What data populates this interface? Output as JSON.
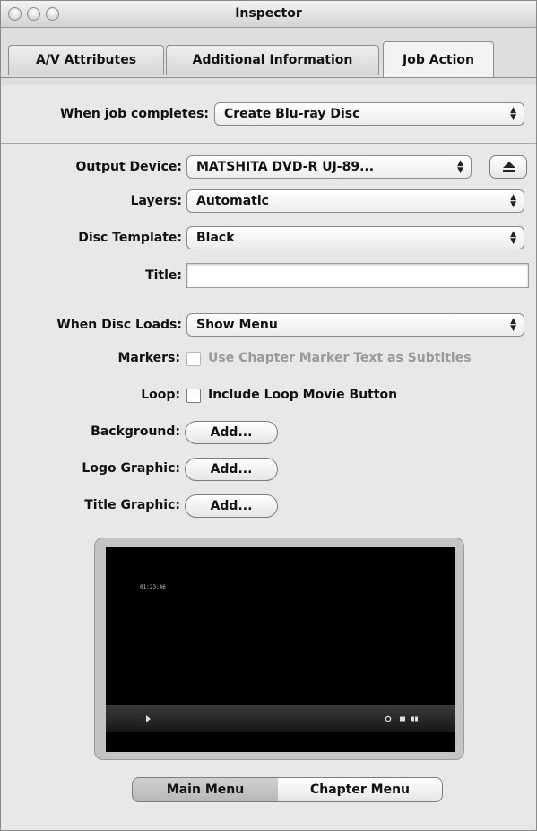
{
  "window": {
    "title": "Inspector"
  },
  "tabs": [
    {
      "label": "A/V Attributes",
      "active": false
    },
    {
      "label": "Additional Information",
      "active": false
    },
    {
      "label": "Job Action",
      "active": true
    }
  ],
  "job": {
    "label": "When job completes:",
    "value": "Create Blu-ray Disc"
  },
  "output_device": {
    "label": "Output Device:",
    "value": "MATSHITA DVD-R   UJ-89..."
  },
  "layers": {
    "label": "Layers:",
    "value": "Automatic"
  },
  "disc_template": {
    "label": "Disc Template:",
    "value": "Black"
  },
  "title_field": {
    "label": "Title:",
    "value": ""
  },
  "when_disc_loads": {
    "label": "When Disc Loads:",
    "value": "Show Menu"
  },
  "markers": {
    "label": "Markers:",
    "checkbox_label": "Use Chapter Marker Text as Subtitles",
    "checked": false,
    "enabled": false
  },
  "loop": {
    "label": "Loop:",
    "checkbox_label": "Include Loop Movie Button",
    "checked": false
  },
  "background": {
    "label": "Background:",
    "button": "Add..."
  },
  "logo_graphic": {
    "label": "Logo Graphic:",
    "button": "Add..."
  },
  "title_graphic": {
    "label": "Title Graphic:",
    "button": "Add..."
  },
  "preview": {
    "timecode": "01:23:46"
  },
  "menu_segments": [
    {
      "label": "Main Menu",
      "selected": true
    },
    {
      "label": "Chapter Menu",
      "selected": false
    }
  ],
  "icons": [
    "close-icon",
    "minimize-icon",
    "zoom-icon",
    "eject-icon",
    "updown-arrows-icon",
    "play-icon"
  ]
}
